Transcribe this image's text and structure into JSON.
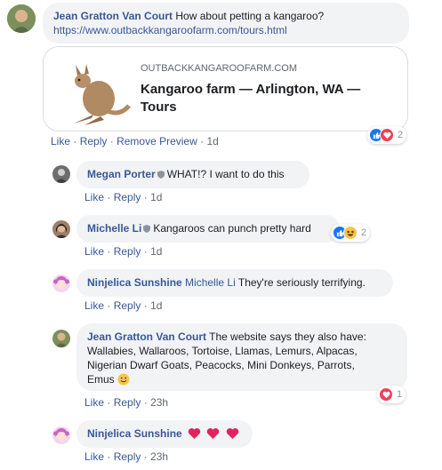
{
  "post": {
    "author": "Jean Gratton Van Court",
    "text": "How about petting a kangaroo?",
    "url": "https://www.outbackkangaroofarm.com/tours.html",
    "preview": {
      "domain": "OUTBACKKANGAROOFARM.COM",
      "title": "Kangaroo farm — Arlington, WA — Tours"
    },
    "actions": {
      "like": "Like",
      "reply": "Reply",
      "remove_preview": "Remove Preview",
      "time": "1d"
    },
    "reactions": {
      "count": "2",
      "icons": [
        "like-icon",
        "love-icon"
      ]
    }
  },
  "replies": [
    {
      "author": "Megan Porter",
      "text": "WHAT!? I want to do this",
      "time": "1d",
      "badge": "shield-icon"
    },
    {
      "author": "Michelle Li",
      "text": "Kangaroos can punch pretty hard",
      "time": "1d",
      "badge": "shield-icon",
      "reactions": {
        "count": "2",
        "icons": [
          "like-icon",
          "haha-icon"
        ]
      }
    },
    {
      "author": "Ninjelica Sunshine",
      "mention": "Michelle Li",
      "text": "They're seriously terrifying.",
      "time": "1d"
    },
    {
      "author": "Jean Gratton Van Court",
      "text_lines": [
        "The website says they also have:",
        "Wallabies, Wallaroos, Tortoise, Llamas, Lemurs, Alpacas,",
        "Nigerian Dwarf Goats, Peacocks, Mini Donkeys, Parrots,",
        "Emus"
      ],
      "time": "23h",
      "emoji": "smile-emoji",
      "reactions": {
        "count": "1",
        "icons": [
          "love-icon"
        ]
      }
    },
    {
      "author": "Ninjelica Sunshine",
      "emojis": [
        "heart-emoji",
        "heart-emoji",
        "heart-emoji"
      ],
      "time": "23h"
    }
  ],
  "labels": {
    "like": "Like",
    "reply": "Reply",
    "sep": "·"
  },
  "colors": {
    "link": "#385898",
    "bubble": "#f2f3f5",
    "like_blue": "#1877f2",
    "love_red": "#f33e58"
  }
}
